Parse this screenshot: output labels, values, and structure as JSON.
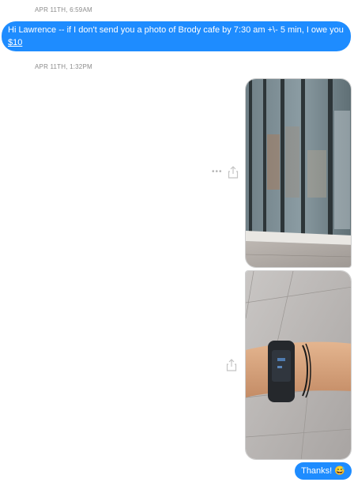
{
  "thread": {
    "timestamp_1": "APR 11TH, 6:59AM",
    "message_1": {
      "text_prefix": "Hi Lawrence -- if I don't send you a photo of Brody cafe by 7:30 am +\\- 5 min, I owe you ",
      "link_text": "$10"
    },
    "timestamp_2": "APR 11TH, 1:32PM",
    "photos": [
      {
        "name": "building-photo"
      },
      {
        "name": "wrist-fitness-band-photo"
      }
    ],
    "message_2": {
      "text": "Thanks!",
      "emoji": "😅"
    }
  },
  "icons": {
    "more": "more-options-icon",
    "share": "share-icon"
  },
  "colors": {
    "accent_bubble": "#1e8cff",
    "timestamp_text": "#8c8c8c"
  }
}
